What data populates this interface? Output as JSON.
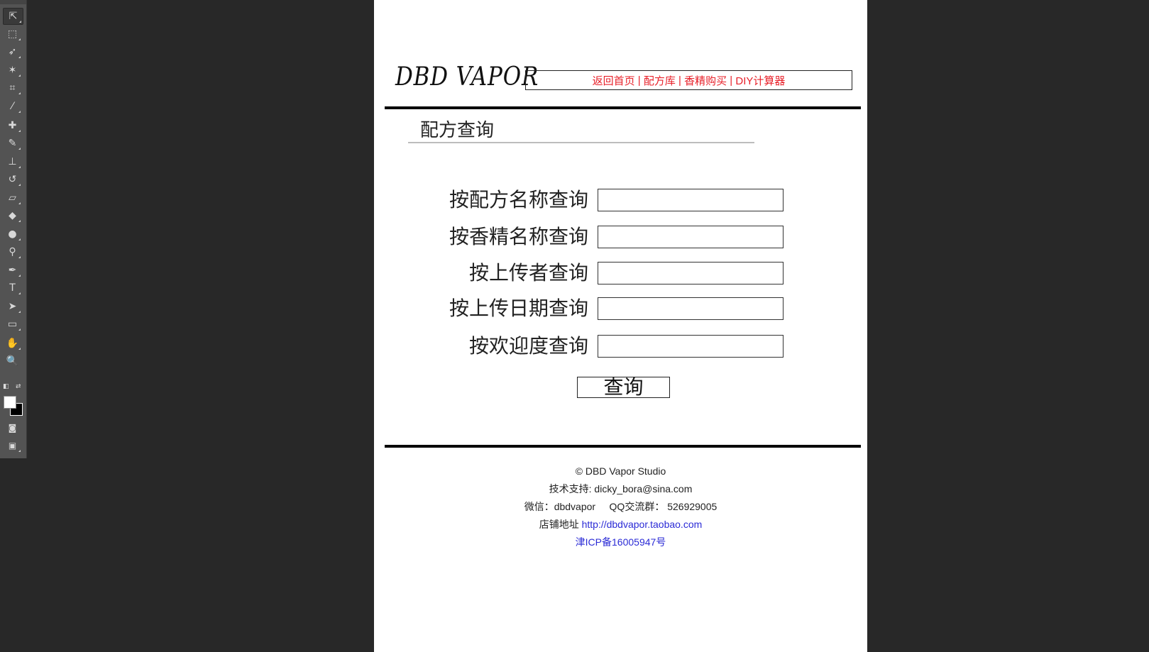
{
  "toolbar": {
    "tools": [
      {
        "name": "move-tool-icon",
        "glyph": "⇱"
      },
      {
        "name": "marquee-tool-icon",
        "glyph": "⬚"
      },
      {
        "name": "lasso-tool-icon",
        "glyph": "➶"
      },
      {
        "name": "magic-wand-tool-icon",
        "glyph": "✶"
      },
      {
        "name": "crop-tool-icon",
        "glyph": "⌗"
      },
      {
        "name": "eyedropper-tool-icon",
        "glyph": "⁄"
      },
      {
        "name": "healing-brush-tool-icon",
        "glyph": "✚"
      },
      {
        "name": "brush-tool-icon",
        "glyph": "✎"
      },
      {
        "name": "clone-stamp-tool-icon",
        "glyph": "⊥"
      },
      {
        "name": "history-brush-tool-icon",
        "glyph": "↺"
      },
      {
        "name": "eraser-tool-icon",
        "glyph": "▱"
      },
      {
        "name": "paint-bucket-tool-icon",
        "glyph": "◆"
      },
      {
        "name": "blur-tool-icon",
        "glyph": "●"
      },
      {
        "name": "dodge-tool-icon",
        "glyph": "⚲"
      },
      {
        "name": "pen-tool-icon",
        "glyph": "✒"
      },
      {
        "name": "type-tool-icon",
        "glyph": "T"
      },
      {
        "name": "path-selection-tool-icon",
        "glyph": "➤"
      },
      {
        "name": "rectangle-tool-icon",
        "glyph": "▭"
      },
      {
        "name": "hand-tool-icon",
        "glyph": "✋"
      },
      {
        "name": "zoom-tool-icon",
        "glyph": "🔍"
      }
    ]
  },
  "page": {
    "logo": "DBD VAPOR",
    "nav": {
      "home": "返回首页",
      "recipes": "配方库",
      "buy": "香精购买",
      "calculator": "DIY计算器",
      "separator": " | "
    },
    "section_title": "配方查询",
    "search_fields": [
      {
        "label": "按配方名称查询",
        "value": ""
      },
      {
        "label": "按香精名称查询",
        "value": ""
      },
      {
        "label": "按上传者查询",
        "value": ""
      },
      {
        "label": "按上传日期查询",
        "value": ""
      },
      {
        "label": "按欢迎度查询",
        "value": ""
      }
    ],
    "submit_label": "查询",
    "footer": {
      "copyright": "© DBD Vapor Studio",
      "support": "技术支持: dicky_bora@sina.com",
      "wechat": "微信：dbdvapor",
      "qq": "QQ交流群： 526929005",
      "shop_label": "店铺地址 ",
      "shop_url": "http://dbdvapor.taobao.com",
      "icp": "津ICP备16005947号"
    }
  },
  "colors": {
    "workspace": "#282828",
    "toolbar": "#535353",
    "nav_text": "#e8212a",
    "link": "#2b2bd6"
  }
}
